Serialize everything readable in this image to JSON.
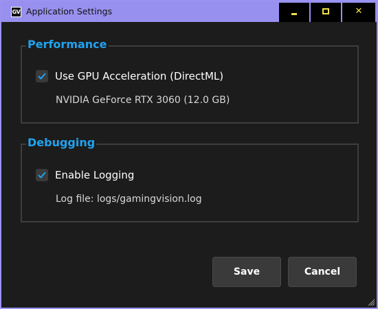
{
  "window": {
    "title": "Application Settings",
    "icon_text": "GV",
    "icon": "app-logo-icon",
    "border_color": "#9b93f2",
    "accent_color": "#20a3f0",
    "caption_glyph_color": "#f2e04a",
    "controls": {
      "minimize": "minimize-icon",
      "maximize": "maximize-icon",
      "close": "close-icon",
      "close_glyph": "✕"
    }
  },
  "performance": {
    "title": "Performance",
    "gpu_acceleration": {
      "label": "Use GPU Acceleration (DirectML)",
      "checked": true
    },
    "gpu_name": "NVIDIA GeForce RTX 3060 (12.0 GB)"
  },
  "debugging": {
    "title": "Debugging",
    "logging": {
      "label": "Enable Logging",
      "checked": true
    },
    "log_file": "Log file: logs/gamingvision.log"
  },
  "actions": {
    "save_label": "Save",
    "cancel_label": "Cancel"
  }
}
